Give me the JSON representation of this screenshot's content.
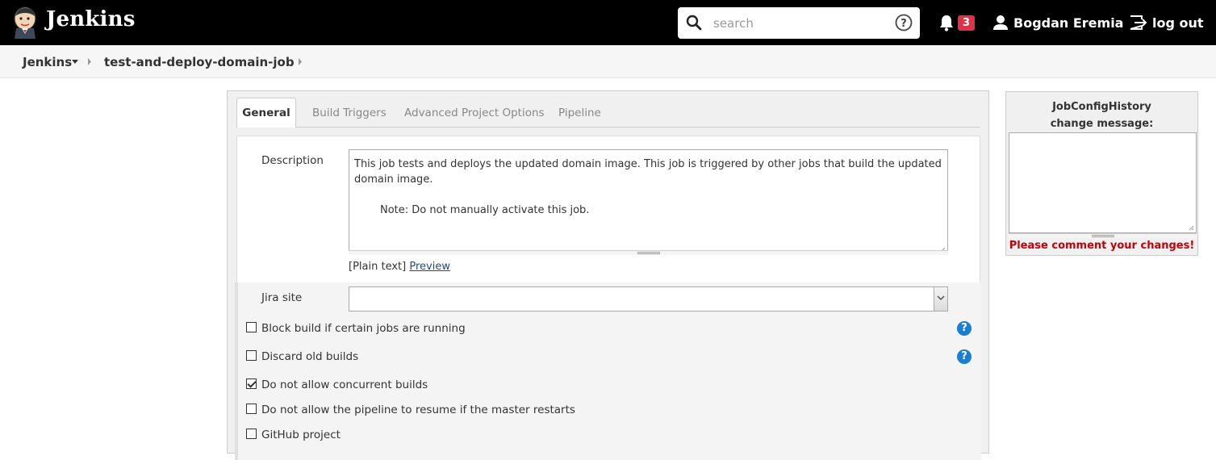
{
  "header": {
    "brand": "Jenkins",
    "search_placeholder": "search",
    "notification_count": "3",
    "user_name": "Bogdan Eremia",
    "logout_label": "log out"
  },
  "breadcrumb": {
    "root": "Jenkins",
    "job": "test-and-deploy-domain-job"
  },
  "tabs": [
    "General",
    "Build Triggers",
    "Advanced Project Options",
    "Pipeline"
  ],
  "form": {
    "description_label": "Description",
    "description_text": "This job tests and deploys the updated domain image. This job is triggered by other jobs that build the updated domain image.",
    "description_note": "Note: Do not manually activate this job.",
    "format_prefix": "[Plain text]",
    "preview_label": "Preview",
    "jira_label": "Jira site",
    "jira_value": "",
    "options": [
      {
        "label": "Block build if certain jobs are running",
        "checked": false,
        "help": true
      },
      {
        "label": "Discard old builds",
        "checked": false,
        "help": true
      },
      {
        "label": "Do not allow concurrent builds",
        "checked": true,
        "help": false
      },
      {
        "label": "Do not allow the pipeline to resume if the master restarts",
        "checked": false,
        "help": false
      },
      {
        "label": "GitHub project",
        "checked": false,
        "help": false
      }
    ]
  },
  "side_panel": {
    "title_line1": "JobConfigHistory",
    "title_line2": "change message:",
    "warning": "Please comment your changes!"
  },
  "colors": {
    "header_bg": "#000000",
    "badge": "#e0314b",
    "help_icon": "#1a7fd1",
    "warning_text": "#c4000a"
  }
}
